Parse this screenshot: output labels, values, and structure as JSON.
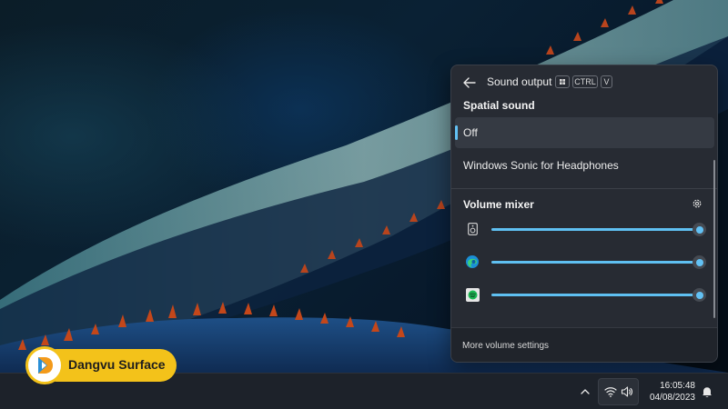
{
  "flyout": {
    "title": "Sound output",
    "shortcut_keys": [
      "CTRL",
      "V"
    ],
    "spatial_section_title": "Spatial sound",
    "spatial_options": [
      {
        "label": "Off",
        "selected": true
      },
      {
        "label": "Windows Sonic for Headphones",
        "selected": false
      }
    ],
    "mixer_section_title": "Volume mixer",
    "mixer_rows": [
      {
        "icon": "speaker-device-icon",
        "level_percent": 100
      },
      {
        "icon": "edge-browser-icon",
        "level_percent": 100
      },
      {
        "icon": "spotify-icon",
        "level_percent": 100
      }
    ],
    "footer_link": "More volume settings"
  },
  "taskbar": {
    "time": "16:05:48",
    "date": "04/08/2023"
  },
  "brand": {
    "name": "Dangvu Surface"
  },
  "colors": {
    "accent": "#62c1f4",
    "brand": "#f3c21a"
  }
}
